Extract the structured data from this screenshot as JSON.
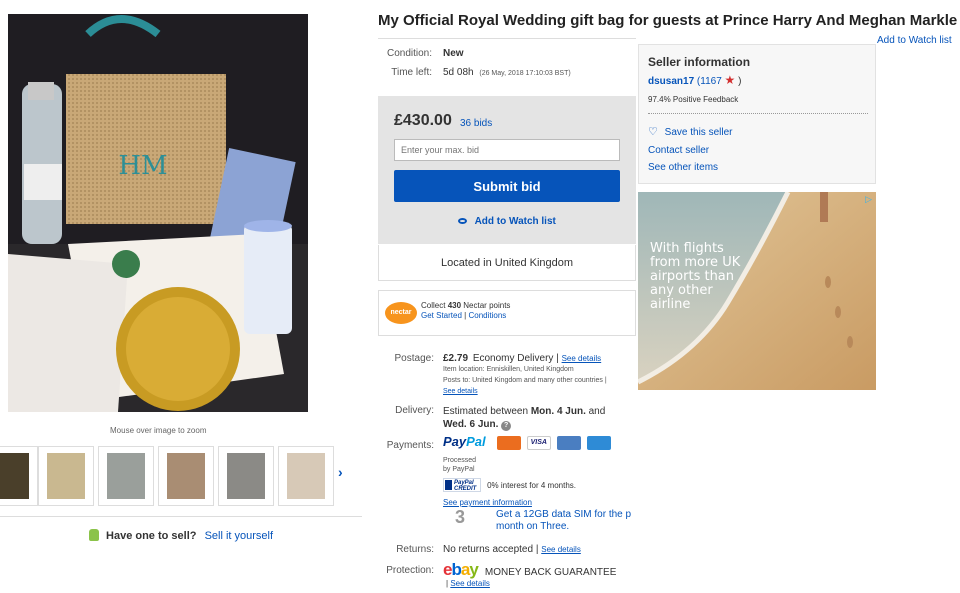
{
  "gallery": {
    "zoom_hint": "Mouse over image to zoom",
    "next_arrow": "›",
    "sell_prompt": "Have one to sell?",
    "sell_link": "Sell it yourself"
  },
  "listing": {
    "title": "My Official Royal Wedding gift bag for guests at Prince Harry And Meghan Markle",
    "add_to_watch_top": "Add to Watch list",
    "condition_label": "Condition:",
    "condition_value": "New",
    "time_left_label": "Time left:",
    "time_left_value": "5d 08h",
    "time_left_date": "(26 May, 2018  17:10:03 BST)"
  },
  "bid": {
    "price": "£430.00",
    "bids": "36 bids",
    "input_placeholder": "Enter your max. bid",
    "submit_label": "Submit bid",
    "watch_label": "Add to Watch list",
    "located": "Located in United Kingdom"
  },
  "nectar": {
    "logo": "nectar",
    "line1_prefix": "Collect",
    "points": "430",
    "line1_suffix": "Nectar points",
    "get_started": "Get Started",
    "separator": "|",
    "conditions": "Conditions"
  },
  "postage": {
    "label": "Postage:",
    "price": "£2.79",
    "service": "Economy Delivery",
    "sep": "|",
    "see_details": "See details",
    "item_location": "Item location:  Enniskillen, United Kingdom",
    "posts_to": "Posts to:  United Kingdom and many other countries |",
    "see_details2": "See details"
  },
  "delivery": {
    "label": "Delivery:",
    "prefix": "Estimated between",
    "date1": "Mon. 4 Jun.",
    "and": "and",
    "date2": "Wed. 6 Jun.",
    "info_icon": "?"
  },
  "payments": {
    "label": "Payments:",
    "paypal_a": "Pay",
    "paypal_b": "Pal",
    "processed": "Processed",
    "by_paypal": "by PayPal",
    "credit_logo_top": "PayPal",
    "credit_logo_bottom": "CREDIT",
    "credit_text": "0% interest for 4 months.",
    "see_payment": "See payment information",
    "three_logo": "3",
    "sim_line1": "Get a 12GB data SIM for the p",
    "sim_line2": "month on Three.",
    "colors": {
      "mastercard": "#eb6d1f",
      "visa": "#1a1f71",
      "maestro": "#4a7ec1",
      "amex": "#2e8bd6"
    },
    "visa_text": "VISA"
  },
  "returns": {
    "label": "Returns:",
    "value": "No returns accepted",
    "sep": "|",
    "see_details": "See details"
  },
  "protection": {
    "label": "Protection:",
    "ebay_e": "e",
    "ebay_b": "b",
    "ebay_a": "a",
    "ebay_y": "y",
    "mbg": "MONEY BACK GUARANTEE",
    "sep": "|",
    "see_details": "See details"
  },
  "seller": {
    "title": "Seller information",
    "name": "dsusan17",
    "score": "(1167",
    "score_close": ")",
    "star_icon": "★",
    "feedback": "97.4% Positive Feedback",
    "save": "Save this seller",
    "contact": "Contact seller",
    "other": "See other items"
  },
  "ad": {
    "line1": "With flights",
    "line2": "from more UK",
    "line3": "airports than",
    "line4": "any other",
    "line5": "airline",
    "choice_icon": "▷"
  }
}
